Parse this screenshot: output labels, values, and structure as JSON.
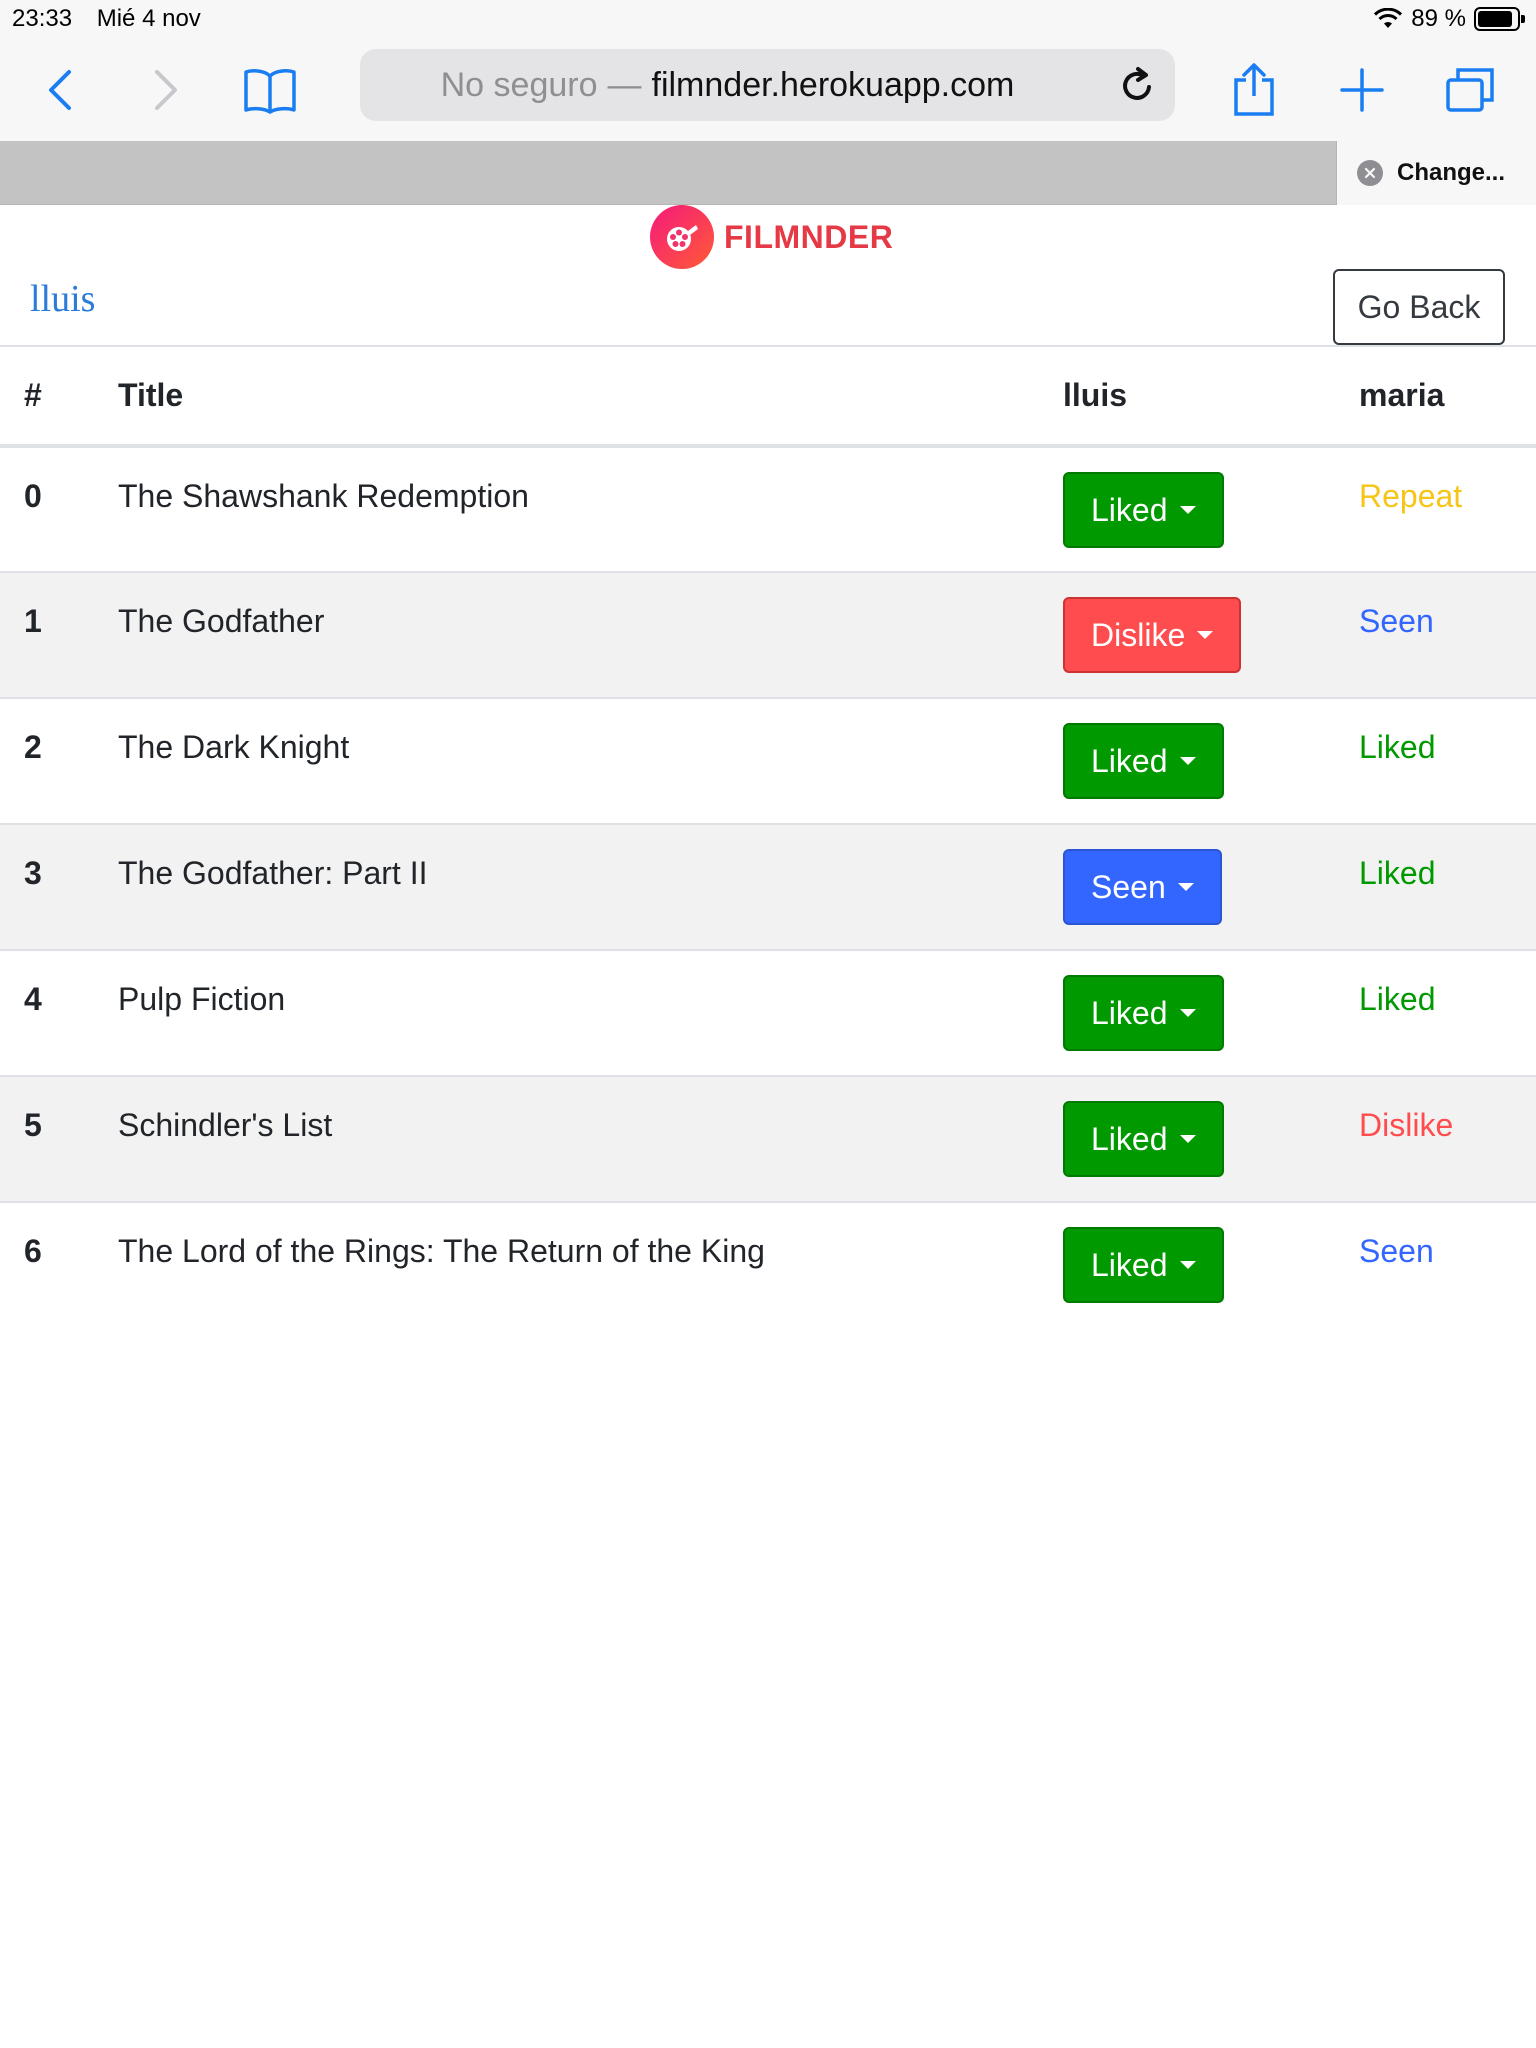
{
  "status_bar": {
    "time": "23:33",
    "date": "Mié 4 nov",
    "battery": "89 %"
  },
  "browser": {
    "address_prefix": "No seguro",
    "address_separator": "—",
    "address_host": "filmnder.herokuapp.com",
    "tab_title": "Change..."
  },
  "app": {
    "logo_text": "FILMNDER",
    "user": "lluis",
    "go_back_label": "Go Back"
  },
  "table": {
    "headers": [
      "#",
      "Title",
      "lluis",
      "maria"
    ],
    "rows": [
      {
        "num": "0",
        "title": "The Shawshank Redemption",
        "lluis": "Liked",
        "maria": "Repeat"
      },
      {
        "num": "1",
        "title": "The Godfather",
        "lluis": "Dislike",
        "maria": "Seen"
      },
      {
        "num": "2",
        "title": "The Dark Knight",
        "lluis": "Liked",
        "maria": "Liked"
      },
      {
        "num": "3",
        "title": "The Godfather: Part II",
        "lluis": "Seen",
        "maria": "Liked"
      },
      {
        "num": "4",
        "title": "Pulp Fiction",
        "lluis": "Liked",
        "maria": "Liked"
      },
      {
        "num": "5",
        "title": "Schindler's List",
        "lluis": "Liked",
        "maria": "Dislike"
      },
      {
        "num": "6",
        "title": "The Lord of the Rings: The Return of the King",
        "lluis": "Liked",
        "maria": "Seen"
      }
    ]
  },
  "colors": {
    "Liked": "#009900",
    "Dislike": "#ff4d4f",
    "Seen": "#3366ff",
    "Repeat": "#f5c518",
    "link": "#2b7bd9",
    "brand": "#e63946",
    "ios_blue": "#1a7ef2"
  }
}
